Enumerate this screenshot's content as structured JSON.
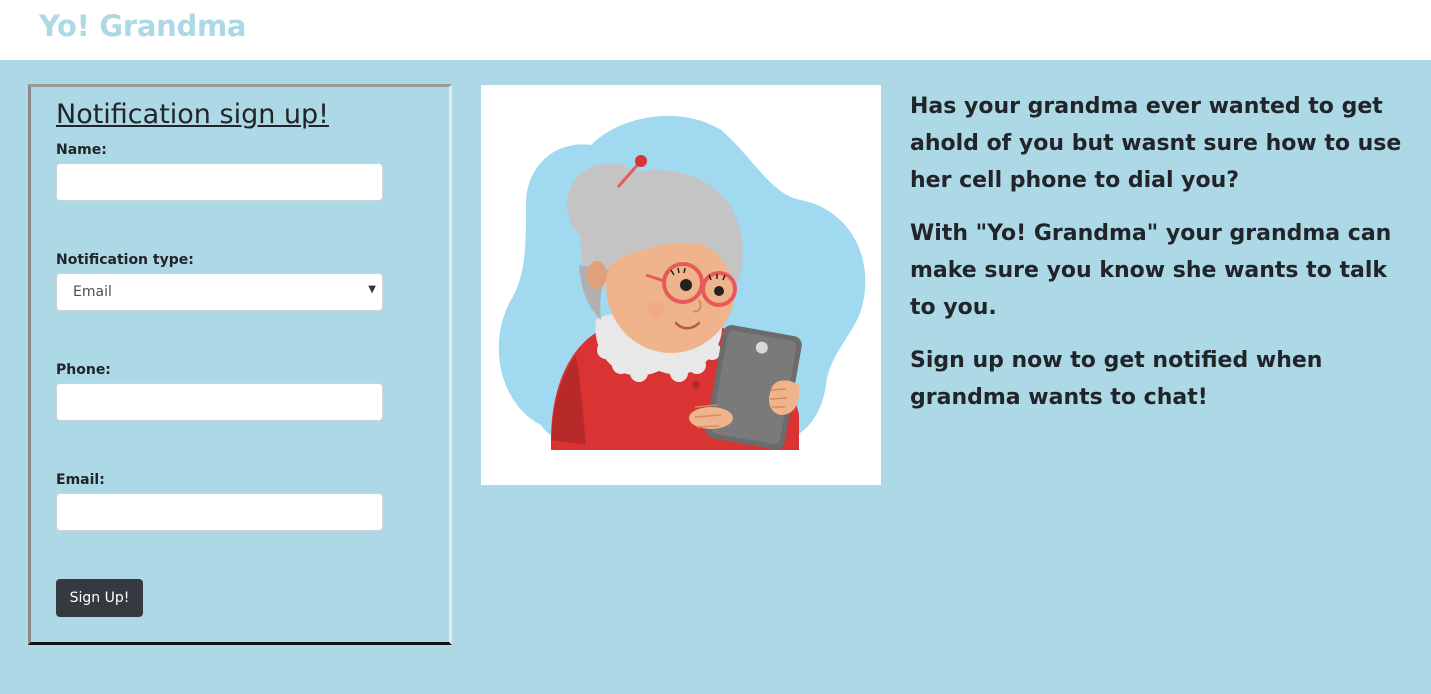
{
  "navbar": {
    "brand": "Yo! Grandma"
  },
  "form": {
    "title": "Notification sign up!",
    "fields": [
      {
        "label": "Name:",
        "value": "",
        "placeholder": ""
      },
      {
        "label": "Notification type:",
        "selected": "Email"
      },
      {
        "label": "Phone:",
        "value": "",
        "placeholder": ""
      },
      {
        "label": "Email:",
        "value": "",
        "placeholder": ""
      }
    ],
    "submit_label": "Sign Up!"
  },
  "illustration": {
    "subject": "grandma-with-tablet",
    "colors": {
      "cloud": "#a0d9f0",
      "hair": "#c4c4c4",
      "skin": "#f0b48c",
      "sweater": "#d93333",
      "collar": "#e8e8e8",
      "tablet": "#6b6b6b",
      "glasses": "#e85a5a"
    }
  },
  "copy": {
    "paragraphs": [
      "Has your grandma ever wanted to get ahold of you but wasnt sure how to use her cell phone to dial you?",
      "With \"Yo! Grandma\" your grandma can make sure you know she wants to talk to you.",
      "Sign up now to get notified when grandma wants to chat!"
    ]
  },
  "theme": {
    "background": "#add8e6",
    "navbar_bg": "#ffffff",
    "brand_color": "#add8e6",
    "button_bg": "#343a40"
  }
}
